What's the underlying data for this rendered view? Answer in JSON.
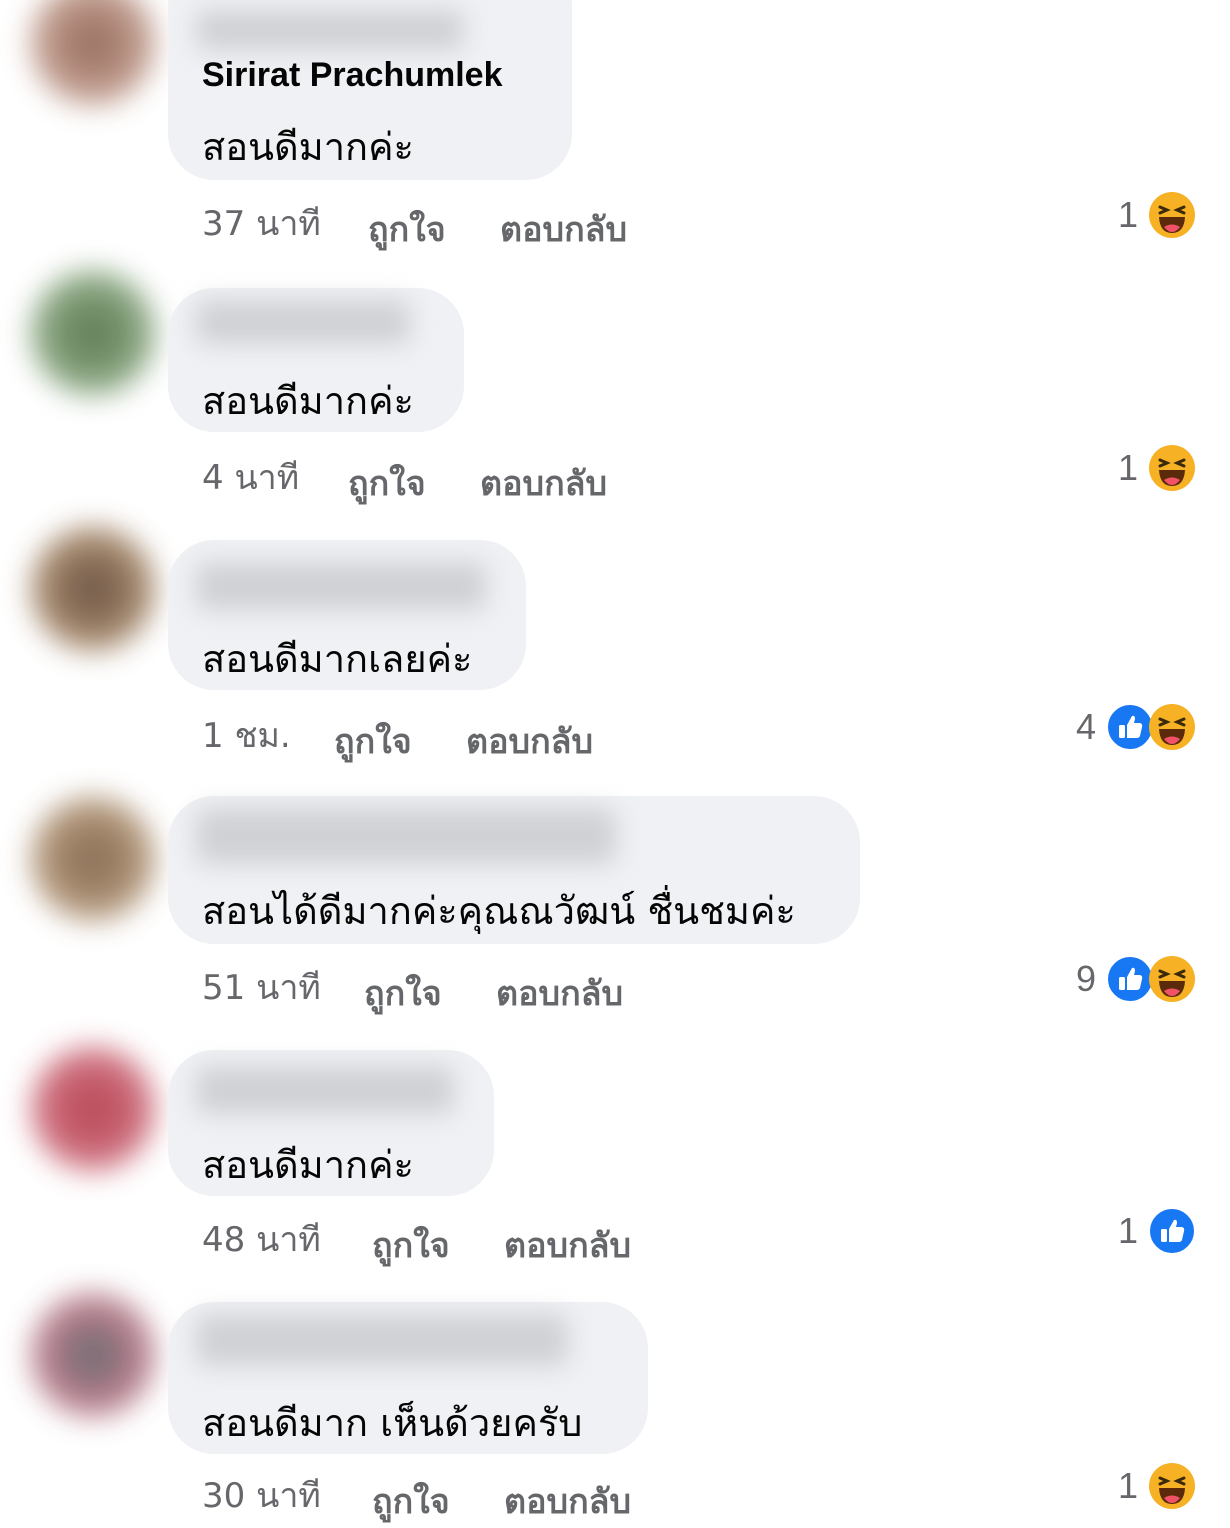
{
  "comments": [
    {
      "name": "Sirirat Prachumlek",
      "text": "สอนดีมากค่ะ",
      "time": "37 นาที",
      "like": "ถูกใจ",
      "reply": "ตอบกลับ",
      "count": "1",
      "reactions": [
        "haha-icon"
      ]
    },
    {
      "name": "",
      "text": "สอนดีมากค่ะ",
      "time": "4 นาที",
      "like": "ถูกใจ",
      "reply": "ตอบกลับ",
      "count": "1",
      "reactions": [
        "haha-icon"
      ]
    },
    {
      "name": "",
      "text": "สอนดีมากเลยค่ะ",
      "time": "1 ชม.",
      "like": "ถูกใจ",
      "reply": "ตอบกลับ",
      "count": "4",
      "reactions": [
        "like-icon",
        "haha-icon"
      ]
    },
    {
      "name": "",
      "text": "สอนได้ดีมากค่ะคุณณวัฒน์ ชื่นชมค่ะ",
      "time": "51 นาที",
      "like": "ถูกใจ",
      "reply": "ตอบกลับ",
      "count": "9",
      "reactions": [
        "like-icon",
        "haha-icon"
      ]
    },
    {
      "name": "",
      "text": "สอนดีมากค่ะ",
      "time": "48 นาที",
      "like": "ถูกใจ",
      "reply": "ตอบกลับ",
      "count": "1",
      "reactions": [
        "like-icon"
      ]
    },
    {
      "name": "",
      "text": "สอนดีมาก เห็นด้วยครับ",
      "time": "30 นาที",
      "like": "ถูกใจ",
      "reply": "ตอบกลับ",
      "count": "1",
      "reactions": [
        "haha-icon"
      ]
    }
  ],
  "colors": {
    "bubble": "#eff1f4",
    "meta": "#65676b",
    "like": "#1877f2",
    "haha": "#f7b125"
  }
}
